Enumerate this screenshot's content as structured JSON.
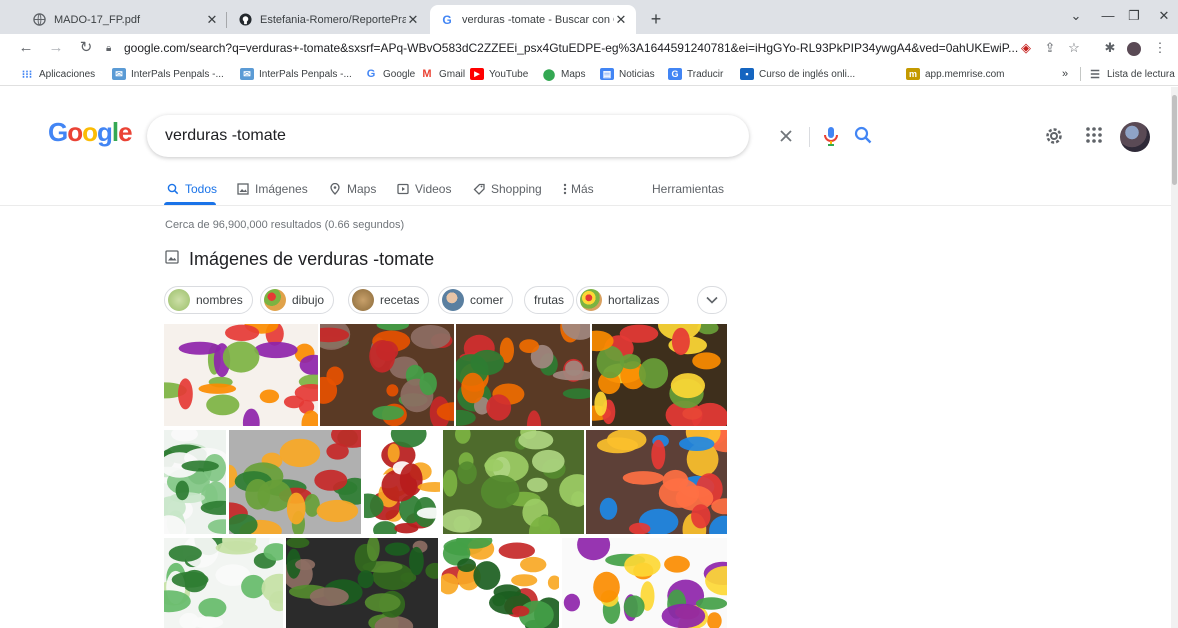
{
  "browser": {
    "tabs": [
      {
        "title": "MADO-17_FP.pdf",
        "icon": "globe-icon"
      },
      {
        "title": "Estefania-Romero/ReportePractic",
        "icon": "github-icon"
      },
      {
        "title": "verduras -tomate - Buscar con G",
        "icon": "google-icon",
        "active": true
      }
    ],
    "url": "google.com/search?q=verduras+-tomate&sxsrf=APq-WBvO583dC2ZZEEi_psx4GtuEDPE-eg%3A1644591240781&ei=iHgGYo-RL93PkPIP34ywgA4&ved=0ahUKEwiP...",
    "bookmarks": [
      {
        "label": "Aplicaciones",
        "icon": "apps-grid-icon",
        "color": "#4285f4"
      },
      {
        "label": "InterPals Penpals -...",
        "icon": "mail-icon",
        "color": "#5b9bd5"
      },
      {
        "label": "InterPals Penpals -...",
        "icon": "mail-icon",
        "color": "#5b9bd5"
      },
      {
        "label": "Google",
        "icon": "google-icon",
        "color": "#4285f4"
      },
      {
        "label": "Gmail",
        "icon": "gmail-icon",
        "color": "#ea4335"
      },
      {
        "label": "YouTube",
        "icon": "youtube-icon",
        "color": "#ff0000"
      },
      {
        "label": "Maps",
        "icon": "maps-pin-icon",
        "color": "#34a853"
      },
      {
        "label": "Noticias",
        "icon": "news-icon",
        "color": "#4285f4"
      },
      {
        "label": "Traducir",
        "icon": "translate-icon",
        "color": "#4285f4"
      },
      {
        "label": "Curso de inglés onli...",
        "icon": "course-icon",
        "color": "#1565c0"
      },
      {
        "label": "app.memrise.com",
        "icon": "memrise-icon",
        "color": "#c49a00"
      }
    ],
    "reading_list": "Lista de lectura",
    "more_bookmarks": "»"
  },
  "google": {
    "logo": "Google",
    "query": "verduras -tomate",
    "tabs": [
      {
        "label": "Todos",
        "icon": "search-icon",
        "active": true
      },
      {
        "label": "Imágenes",
        "icon": "image-icon"
      },
      {
        "label": "Maps",
        "icon": "map-pin-icon"
      },
      {
        "label": "Videos",
        "icon": "play-icon"
      },
      {
        "label": "Shopping",
        "icon": "tag-icon"
      },
      {
        "label": "Más",
        "icon": "more-vert-icon"
      }
    ],
    "tools": "Herramientas",
    "result_stats": "Cerca de 96,900,000 resultados (0.66 segundos)",
    "images_heading": "Imágenes de verduras -tomate",
    "chips": [
      {
        "label": "nombres",
        "thumb": "#9bbf6a"
      },
      {
        "label": "dibujo",
        "thumb": "#e0a24a"
      },
      {
        "label": "recetas",
        "thumb": "#8a6a3a"
      },
      {
        "label": "comer",
        "thumb": "#c99a7a"
      },
      {
        "label": "frutas",
        "thumb": null
      },
      {
        "label": "hortalizas",
        "thumb": "#d8a060"
      }
    ],
    "images": [
      {
        "name": "veggie-heart-image",
        "bg": "#f6f1ec",
        "colors": [
          "#e53935",
          "#7cb342",
          "#fb8c00",
          "#8e24aa"
        ]
      },
      {
        "name": "veggie-pile-image-1",
        "bg": "#5a3a25",
        "colors": [
          "#e65100",
          "#43a047",
          "#c62828",
          "#8d6e63"
        ]
      },
      {
        "name": "veggie-pile-image-2",
        "bg": "#5a3a25",
        "colors": [
          "#ef6c00",
          "#2e7d32",
          "#d32f2f",
          "#a1887f"
        ]
      },
      {
        "name": "fruit-veg-basket-image",
        "bg": "#3e2f1c",
        "colors": [
          "#fdd835",
          "#e53935",
          "#689f38",
          "#fb8c00"
        ]
      },
      {
        "name": "frozen-veg-bag-image-1",
        "bg": "#eef3ef",
        "colors": [
          "#2e7d32",
          "#fafafa",
          "#81c784",
          "#c8e6c9"
        ]
      },
      {
        "name": "broccoli-peppers-image",
        "bg": "#b0b0b0",
        "colors": [
          "#2e7d32",
          "#f9a825",
          "#c62828",
          "#689f38"
        ]
      },
      {
        "name": "la-costena-can-image",
        "bg": "#fff",
        "colors": [
          "#b71c1c",
          "#f9a825",
          "#2e7d32",
          "#fff"
        ]
      },
      {
        "name": "brussels-sprouts-image",
        "bg": "#4e6b2c",
        "colors": [
          "#7cb342",
          "#9ccc65",
          "#558b2f",
          "#aed581"
        ]
      },
      {
        "name": "fruits-mix-image",
        "bg": "#5d4037",
        "colors": [
          "#ff7043",
          "#1e88e5",
          "#fbc02d",
          "#e53935"
        ]
      },
      {
        "name": "frozen-veg-bag-image-2",
        "bg": "#f2f5f2",
        "colors": [
          "#2e7d32",
          "#fafafa",
          "#66bb6a",
          "#c5e1a5"
        ]
      },
      {
        "name": "spinach-bowl-image",
        "bg": "#2b2b2b",
        "colors": [
          "#33691e",
          "#558b2f",
          "#1b5e20",
          "#8d6e63"
        ]
      },
      {
        "name": "del-monte-can-image",
        "bg": "#fff",
        "colors": [
          "#1b5e20",
          "#f9a825",
          "#c62828",
          "#43a047"
        ]
      },
      {
        "name": "fruit-assortment-image",
        "bg": "#fafafa",
        "colors": [
          "#8e24aa",
          "#fdd835",
          "#fb8c00",
          "#43a047"
        ]
      }
    ]
  }
}
